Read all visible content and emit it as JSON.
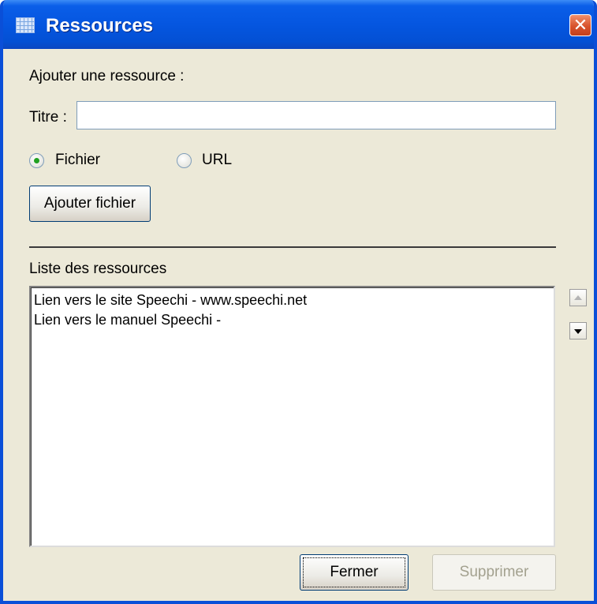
{
  "window": {
    "title": "Ressources",
    "icon": "table-icon",
    "close_icon": "close-icon"
  },
  "add_section": {
    "heading": "Ajouter une ressource :"
  },
  "titre": {
    "label": "Titre :",
    "value": "",
    "placeholder": ""
  },
  "type_options": [
    {
      "label": "Fichier",
      "selected": true
    },
    {
      "label": "URL",
      "selected": false
    }
  ],
  "add_file_button": {
    "label": "Ajouter fichier"
  },
  "resources": {
    "heading": "Liste des ressources",
    "items": [
      "Lien vers le site Speechi - www.speechi.net",
      "Lien vers le manuel Speechi -"
    ]
  },
  "buttons": {
    "close": "Fermer",
    "delete": "Supprimer"
  },
  "colors": {
    "titlebar": "#0556e0",
    "window_bg": "#ece9d8",
    "close_button": "#d8532c",
    "radio_dot": "#21a121"
  }
}
